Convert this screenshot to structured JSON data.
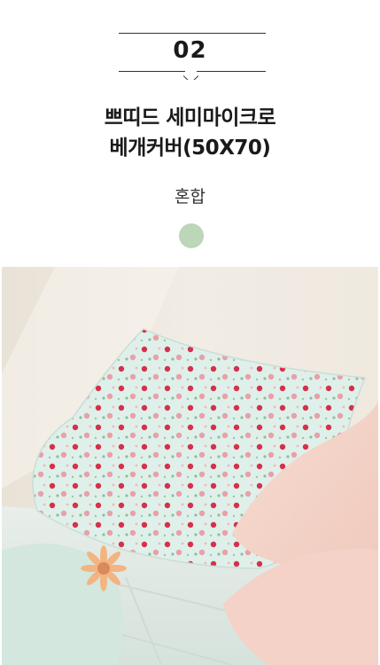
{
  "section": {
    "number": "02",
    "title_line1": "쁘띠드 세미마이크로",
    "title_line2": "베개커버(50X70)",
    "option_label": "혼합"
  },
  "colors": {
    "swatch": "#bcd6b8",
    "rule": "#333333",
    "text": "#1a1a1a"
  },
  "photo": {
    "description_icon": "product-photo-pillows"
  }
}
